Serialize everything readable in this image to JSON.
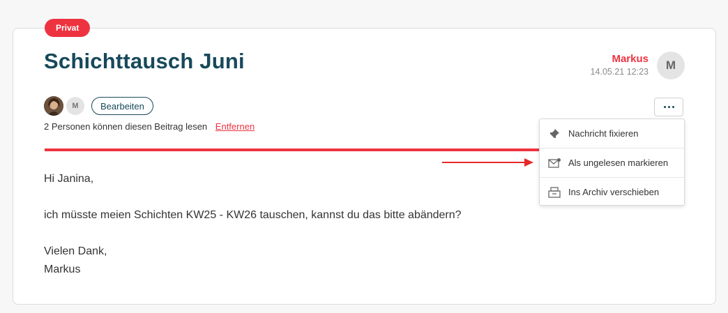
{
  "badge": "Privat",
  "title": "Schichttausch Juni",
  "author": {
    "name": "Markus",
    "timestamp": "14.05.21 12:23",
    "avatar_initial": "M"
  },
  "readers": {
    "avatar_initial": "M",
    "edit_label": "Bearbeiten",
    "info_text": "2 Personen können diesen Beitrag lesen",
    "remove_label": "Entfernen"
  },
  "menu": {
    "items": [
      {
        "label": "Nachricht fixieren",
        "icon": "pin-icon"
      },
      {
        "label": "Als ungelesen markieren",
        "icon": "mail-unread-icon"
      },
      {
        "label": "Ins Archiv verschieben",
        "icon": "archive-icon"
      }
    ]
  },
  "message": {
    "greeting": "Hi Janina,",
    "body": "ich müsste meien Schichten KW25 - KW26 tauschen, kannst du das bitte abändern?",
    "closing": "Vielen Dank,",
    "signature": "Markus"
  },
  "colors": {
    "accent": "#ee3340",
    "primary": "#17495a"
  }
}
